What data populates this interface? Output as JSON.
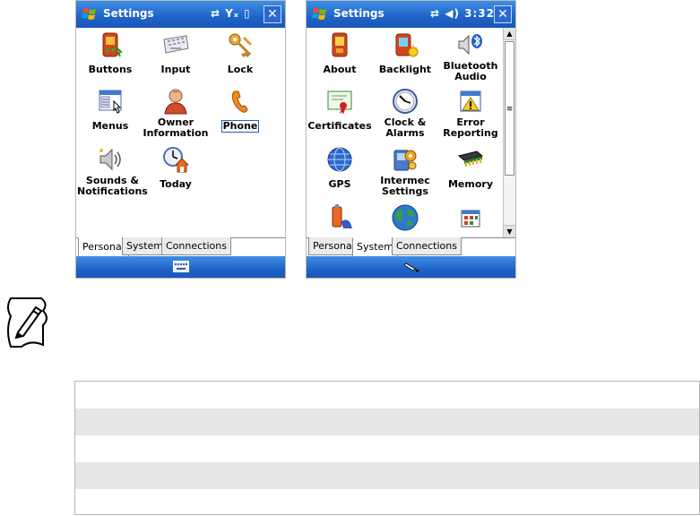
{
  "left_screen": {
    "title": "Settings",
    "status_icons": "⇄ Yₓ ▯",
    "close_label": "✕",
    "items": [
      {
        "label": "Buttons",
        "icon": "buttons-icon"
      },
      {
        "label": "Input",
        "icon": "keyboard-icon"
      },
      {
        "label": "Lock",
        "icon": "keys-icon"
      },
      {
        "label": "Menus",
        "icon": "menus-icon"
      },
      {
        "label": "Owner\nInformation",
        "icon": "owner-icon"
      },
      {
        "label": "Phone",
        "icon": "phone-icon"
      },
      {
        "label": "Sounds &\nNotifications",
        "icon": "speaker-icon"
      },
      {
        "label": "Today",
        "icon": "today-icon"
      }
    ],
    "tabs": [
      "Personal",
      "System",
      "Connections"
    ],
    "active_tab": "Personal"
  },
  "right_screen": {
    "title": "Settings",
    "status_icons": "⇄ ◀) 3:32",
    "close_label": "✕",
    "items": [
      {
        "label": "About",
        "icon": "about-icon"
      },
      {
        "label": "Backlight",
        "icon": "backlight-icon"
      },
      {
        "label": "Bluetooth\nAudio",
        "icon": "bluetooth-audio-icon"
      },
      {
        "label": "Certificates",
        "icon": "certificate-icon"
      },
      {
        "label": "Clock &\nAlarms",
        "icon": "clock-icon"
      },
      {
        "label": "Error\nReporting",
        "icon": "error-reporting-icon"
      },
      {
        "label": "GPS",
        "icon": "globe-gps-icon"
      },
      {
        "label": "Intermec\nSettings",
        "icon": "intermec-settings-icon"
      },
      {
        "label": "Memory",
        "icon": "memory-icon"
      },
      {
        "label": "",
        "icon": "power-icon"
      },
      {
        "label": "",
        "icon": "regional-globe-icon"
      },
      {
        "label": "",
        "icon": "remove-programs-icon"
      }
    ],
    "tabs": [
      "Personal",
      "System",
      "Connections"
    ],
    "active_tab": "System"
  },
  "colors": {
    "titlebar": "#1f63c9",
    "table_shade": "#e6e6e6"
  }
}
